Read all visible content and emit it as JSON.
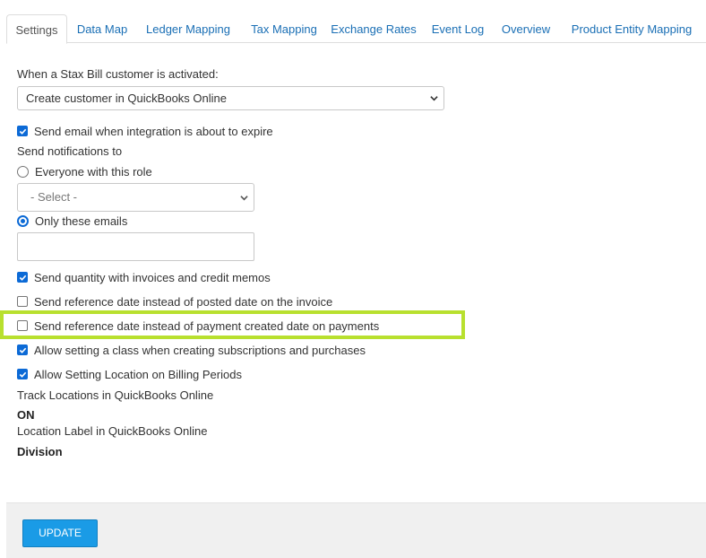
{
  "tabs": [
    {
      "label": "Settings",
      "active": true
    },
    {
      "label": "Data Map"
    },
    {
      "label": "Ledger Mapping"
    },
    {
      "label": "Tax Mapping"
    },
    {
      "label": "Exchange Rates"
    },
    {
      "label": "Event Log"
    },
    {
      "label": "Overview"
    },
    {
      "label": "Product Entity Mapping"
    }
  ],
  "settings": {
    "activation_label": "When a Stax Bill customer is activated:",
    "activation_select": "Create customer in QuickBooks Online",
    "send_email_expire": "Send email when integration is about to expire",
    "notifications_label": "Send notifications to",
    "everyone_role": "Everyone with this role",
    "role_select": "- Select -",
    "only_emails": "Only these emails",
    "emails_value": "",
    "send_quantity": "Send quantity with invoices and credit memos",
    "send_ref_date_invoice": "Send reference date instead of posted date on the invoice",
    "send_ref_date_payments": "Send reference date instead of payment created date on payments",
    "allow_class": "Allow setting a class when creating subscriptions and purchases",
    "allow_location": "Allow Setting Location on Billing Periods",
    "track_locations_label": "Track Locations in QuickBooks Online",
    "track_locations_value": "ON",
    "location_label_label": "Location Label in QuickBooks Online",
    "location_label_value": "Division"
  },
  "footer": {
    "update_label": "UPDATE"
  },
  "colors": {
    "accent": "#0c6ad6",
    "highlight": "#b8e02e",
    "button": "#1a9be6",
    "link": "#1a6fb5"
  }
}
